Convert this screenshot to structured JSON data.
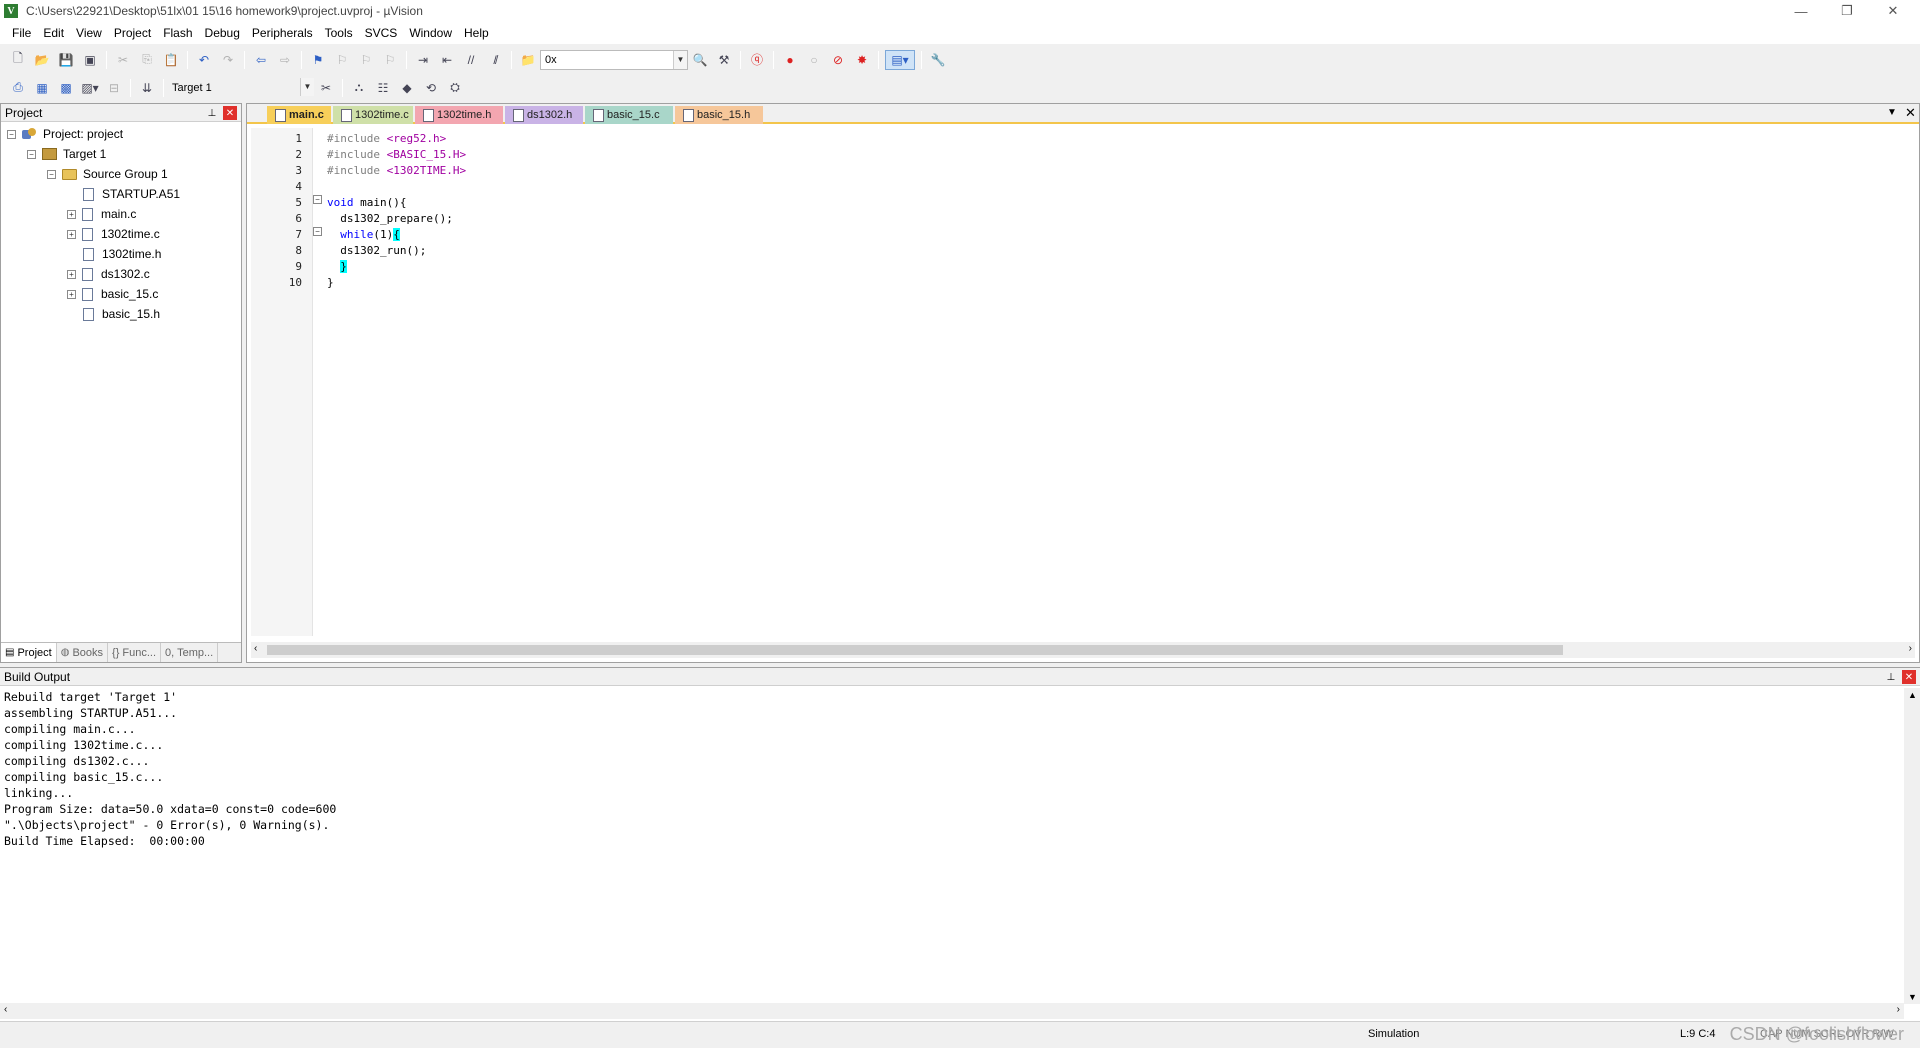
{
  "window": {
    "title": "C:\\Users\\22921\\Desktop\\51lx\\01  15\\16 homework9\\project.uvproj - µVision",
    "minimize": "—",
    "restore": "❐",
    "close": "✕"
  },
  "menu": [
    "File",
    "Edit",
    "View",
    "Project",
    "Flash",
    "Debug",
    "Peripherals",
    "Tools",
    "SVCS",
    "Window",
    "Help"
  ],
  "toolbar1": {
    "address_value": "0x"
  },
  "toolbar2": {
    "target_select": "Target 1"
  },
  "project_panel": {
    "title": "Project",
    "tree": {
      "project": "Project: project",
      "target": "Target 1",
      "group": "Source Group 1",
      "files": [
        "STARTUP.A51",
        "main.c",
        "1302time.c",
        "1302time.h",
        "ds1302.c",
        "basic_15.c",
        "basic_15.h"
      ]
    },
    "tabs": [
      "Project",
      "Books",
      "{} Func...",
      "0, Temp..."
    ]
  },
  "editor": {
    "tabs": [
      {
        "label": "main.c",
        "color": "#f7cf5a"
      },
      {
        "label": "1302time.c",
        "color": "#cfe0a8"
      },
      {
        "label": "1302time.h",
        "color": "#f3a6b0"
      },
      {
        "label": "ds1302.h",
        "color": "#c9b3e6"
      },
      {
        "label": "basic_15.c",
        "color": "#a9d6c9"
      },
      {
        "label": "basic_15.h",
        "color": "#f6c79a"
      }
    ],
    "line_numbers": [
      "1",
      "2",
      "3",
      "4",
      "5",
      "6",
      "7",
      "8",
      "9",
      "10"
    ],
    "code": {
      "l1_pp": "#include",
      "l1_inc": " <reg52.h>",
      "l2_pp": "#include",
      "l2_inc": " <BASIC_15.H>",
      "l3_pp": "#include",
      "l3_inc": " <1302TIME.H>",
      "l5_kw": "void",
      "l5_rest": " main(){",
      "l6": "  ds1302_prepare();",
      "l7_indent": "  ",
      "l7_kw": "while",
      "l7_rest": "(1)",
      "l7_brace": "{",
      "l8": "  ds1302_run();",
      "l9_indent": "  ",
      "l9_brace": "}",
      "l10": "}"
    }
  },
  "build_output": {
    "title": "Build Output",
    "lines": [
      "Rebuild target 'Target 1'",
      "assembling STARTUP.A51...",
      "compiling main.c...",
      "compiling 1302time.c...",
      "compiling ds1302.c...",
      "compiling basic_15.c...",
      "linking...",
      "Program Size: data=50.0 xdata=0 const=0 code=600",
      "\".\\Objects\\project\" - 0 Error(s), 0 Warning(s).",
      "Build Time Elapsed:  00:00:00"
    ]
  },
  "status": {
    "mode": "Simulation",
    "position": "L:9 C:4",
    "flags": "CAP NUM SCRL OVR R/W",
    "watermark": "CSDN @foolishflower"
  }
}
